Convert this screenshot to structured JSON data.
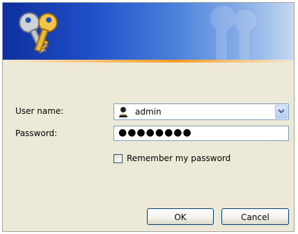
{
  "form": {
    "username_label": "User name:",
    "username_value": "admin",
    "password_label": "Password:",
    "password_mask": "●●●●●●●●",
    "remember_label": "Remember my password",
    "remember_checked": false
  },
  "buttons": {
    "ok_label": "OK",
    "cancel_label": "Cancel"
  },
  "icons": {
    "banner": "keys-icon",
    "watermark": "keys-watermark-icon",
    "user": "user-icon",
    "dropdown": "chevron-down-icon"
  },
  "colors": {
    "dialog_bg": "#ece9d8",
    "banner_dark": "#0f2f9c",
    "banner_light": "#c6d8f2",
    "accent_stripe": "#f39a22",
    "input_border": "#7f9db9",
    "button_border": "#003c74"
  }
}
